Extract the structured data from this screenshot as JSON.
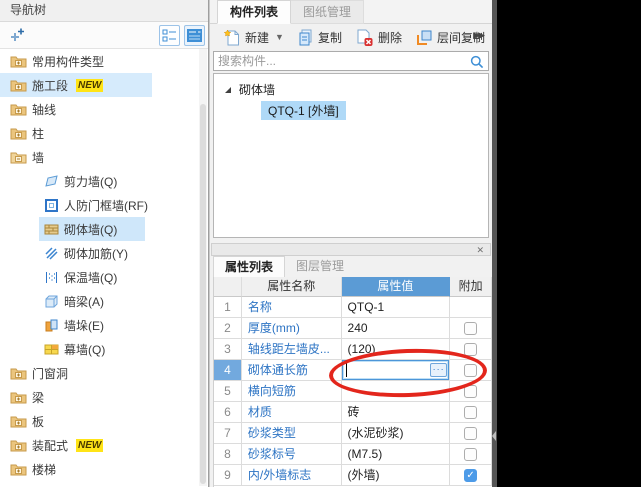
{
  "colors": {
    "accent_blue": "#3E8FD6",
    "value_header_bg": "#5B9BD5",
    "selection_blue": "#AFD9F7",
    "row_hover_blue": "#D6EBFC",
    "annotation_red": "#E3261C",
    "checkbox_checked_blue": "#4D9BE8",
    "new_badge_yellow": "#FFE417",
    "canvas_black": "#000000"
  },
  "nav": {
    "title": "导航树",
    "items": [
      {
        "label": "常用构件类型"
      },
      {
        "label": "施工段",
        "badge": "NEW",
        "highlighted": true
      },
      {
        "label": "轴线"
      },
      {
        "label": "柱"
      },
      {
        "label": "墙",
        "expanded": true
      },
      {
        "label": "剪力墙(Q)"
      },
      {
        "label": "人防门框墙(RF)"
      },
      {
        "label": "砌体墙(Q)",
        "selected": true
      },
      {
        "label": "砌体加筋(Y)"
      },
      {
        "label": "保温墙(Q)"
      },
      {
        "label": "暗梁(A)"
      },
      {
        "label": "墙垛(E)"
      },
      {
        "label": "幕墙(Q)"
      },
      {
        "label": "门窗洞"
      },
      {
        "label": "梁"
      },
      {
        "label": "板"
      },
      {
        "label": "装配式",
        "badge": "NEW"
      },
      {
        "label": "楼梯"
      }
    ]
  },
  "component_panel": {
    "tabs": [
      {
        "label": "构件列表",
        "active": true
      },
      {
        "label": "图纸管理",
        "active": false
      }
    ],
    "toolbar": {
      "new_label": "新建",
      "copy_label": "复制",
      "delete_label": "删除",
      "layer_copy_label": "层间复制",
      "overflow": "▶▶"
    },
    "search_placeholder": "搜索构件...",
    "tree": {
      "group_label": "砌体墙",
      "items": [
        {
          "label": "QTQ-1 [外墙]",
          "selected": true
        }
      ]
    }
  },
  "props_panel": {
    "close_label": "✕",
    "tabs": [
      {
        "label": "属性列表",
        "active": true
      },
      {
        "label": "图层管理",
        "active": false
      }
    ],
    "headers": {
      "name": "属性名称",
      "value": "属性值",
      "attach": "附加"
    },
    "check_glyph": "✓",
    "editor": {
      "ellipsis_label": "···",
      "value": ""
    },
    "rows": [
      {
        "num": "1",
        "name": "名称",
        "value": "QTQ-1"
      },
      {
        "num": "2",
        "name": "厚度(mm)",
        "value": "240"
      },
      {
        "num": "3",
        "name": "轴线距左墙皮...",
        "value": "(120)"
      },
      {
        "num": "4",
        "name": "砌体通长筋",
        "value": ""
      },
      {
        "num": "5",
        "name": "横向短筋",
        "value": ""
      },
      {
        "num": "6",
        "name": "材质",
        "value": "砖"
      },
      {
        "num": "7",
        "name": "砂浆类型",
        "value": "(水泥砂浆)"
      },
      {
        "num": "8",
        "name": "砂浆标号",
        "value": "(M7.5)"
      },
      {
        "num": "9",
        "name": "内/外墙标志",
        "value": "(外墙)"
      }
    ]
  }
}
